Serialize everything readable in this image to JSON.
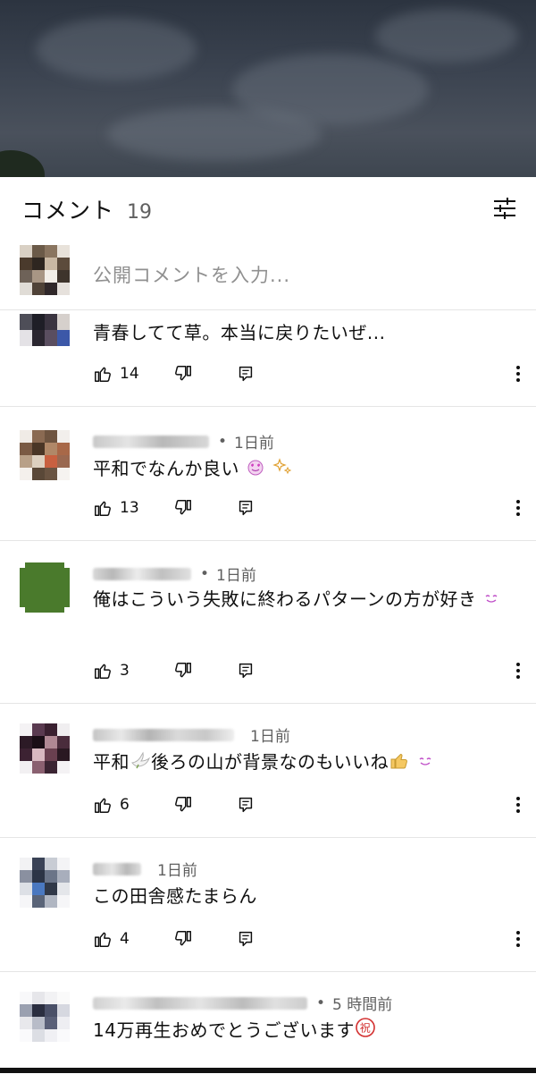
{
  "header": {
    "title": "コメント",
    "count": "19"
  },
  "input": {
    "placeholder": "公開コメントを入力..."
  },
  "comments": [
    {
      "author": "",
      "time": "",
      "text": "青春してて草。本当に戻りたいぜ...",
      "likes": "14",
      "emoji": []
    },
    {
      "author": "",
      "time": "1日前",
      "text": "平和でなんか良い",
      "likes": "13",
      "emoji": [
        "smiling-face-with-hearts",
        "sparkles"
      ]
    },
    {
      "author": "",
      "time": "1日前",
      "text": "俺はこういう失敗に終わるパターンの方が好き",
      "likes": "3",
      "emoji": [
        "smiling-face"
      ]
    },
    {
      "author": "",
      "time": "1日前",
      "text_before": "平和",
      "text": "後ろの山が背景なのもいいね",
      "likes": "6",
      "emoji": [
        "dove",
        "thumbs-up",
        "smiling-face"
      ]
    },
    {
      "author": "",
      "time": "1日前",
      "text": "この田舎感たまらん",
      "likes": "4",
      "emoji": []
    },
    {
      "author": "",
      "time": "5 時間前",
      "text": "14万再生おめでとうございます",
      "likes": "",
      "emoji": [
        "congratulations-ideograph"
      ]
    }
  ],
  "icons": {
    "filter": "sliders-icon",
    "like": "thumbs-up-outline-icon",
    "dislike": "thumbs-down-outline-icon",
    "reply": "reply-comment-icon",
    "more": "vertical-ellipsis-icon"
  },
  "colors": {
    "accent_text": "#0f0f0f",
    "secondary_text": "#606060",
    "divider": "#e5e5e5",
    "congrats": "#d32f2f"
  }
}
